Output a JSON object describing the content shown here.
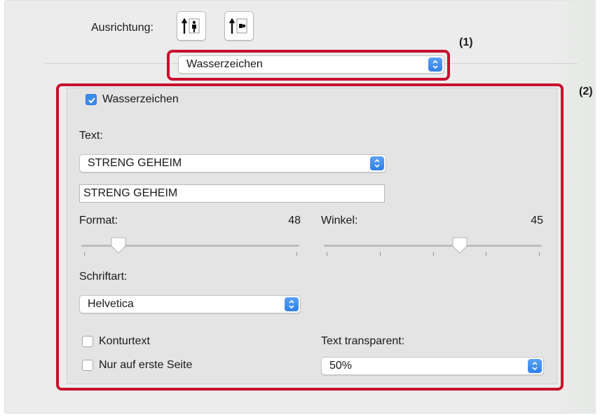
{
  "orientation": {
    "label": "Ausrichtung:",
    "buttons": [
      {
        "name": "portrait-orientation",
        "icon": "portrait-orientation-icon"
      },
      {
        "name": "landscape-orientation",
        "icon": "landscape-orientation-icon"
      }
    ]
  },
  "section_select": {
    "value": "Wasserzeichen"
  },
  "markers": {
    "m1": "(1)",
    "m2": "(2)"
  },
  "watermark": {
    "enabled_label": "Wasserzeichen",
    "enabled": true,
    "text_label": "Text:",
    "text_select_value": "STRENG GEHEIM",
    "text_field_value": "STRENG GEHEIM",
    "format_label": "Format:",
    "format_value": "48",
    "format_level": 0.17,
    "angle_label": "Winkel:",
    "angle_value": "45",
    "angle_level": 0.625,
    "font_label": "Schriftart:",
    "font_value": "Helvetica",
    "outline_label": "Konturtext",
    "outline_checked": false,
    "first_page_label": "Nur auf erste Seite",
    "first_page_checked": false,
    "transparency_label": "Text transparent:",
    "transparency_value": "50%"
  },
  "colors": {
    "highlight": "#c8102e",
    "accent": "#3b8af0"
  }
}
